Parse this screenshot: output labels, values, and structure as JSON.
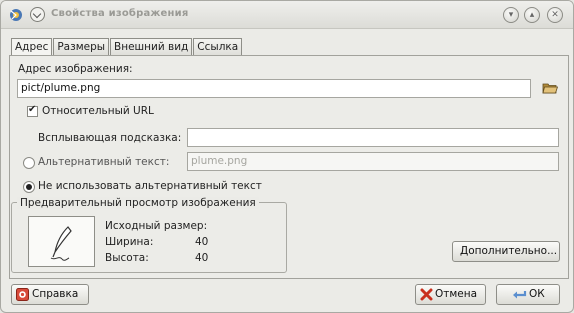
{
  "window": {
    "title": "Свойства изображения"
  },
  "tabs": [
    {
      "label": "Адрес"
    },
    {
      "label": "Размеры"
    },
    {
      "label": "Внешний вид"
    },
    {
      "label": "Ссылка"
    }
  ],
  "address": {
    "label": "Адрес изображения:",
    "value": "pict/plume.png",
    "relative_url_label": "Относительный URL",
    "relative_url_checked": true,
    "tooltip_label": "Всплывающая подсказка:",
    "tooltip_value": "",
    "alt_text_label": "Альтернативный текст:",
    "alt_text_placeholder": "plume.png",
    "no_alt_label": "Не использовать альтернативный текст",
    "selected_option": "no_alt"
  },
  "preview": {
    "group_title": "Предварительный просмотр изображения",
    "original_size_label": "Исходный размер:",
    "width_label": "Ширина:",
    "width_value": "40",
    "height_label": "Высота:",
    "height_value": "40"
  },
  "buttons": {
    "advanced": "Дополнительно...",
    "help": "Справка",
    "cancel": "Отмена",
    "ok": "ОК"
  },
  "colors": {
    "window_bg": "#ebebe7",
    "cancel_icon": "#c0392b",
    "help_icon": "#c0392b",
    "ok_icon": "#4a7ab8"
  },
  "icons": {
    "app": "app-icon",
    "menu": "menu-icon",
    "minimize": "minimize-icon",
    "maximize": "maximize-icon",
    "close": "close-icon",
    "folder": "folder-open-icon",
    "preview": "quill-icon",
    "help": "help-icon",
    "cancel": "cancel-icon",
    "ok": "ok-icon"
  }
}
